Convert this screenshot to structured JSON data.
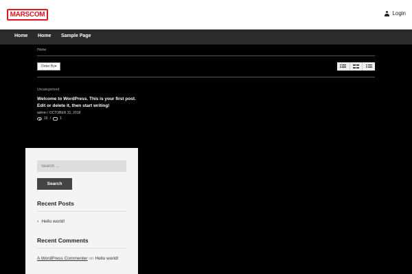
{
  "header": {
    "logo_text": "MARSCOM",
    "login_label": "Login"
  },
  "nav": {
    "items": [
      "Home",
      "Home",
      "Sample Page"
    ]
  },
  "breadcrumb": "Home",
  "toolbar": {
    "order_by_label": "Order By"
  },
  "post": {
    "category": "Uncategorized",
    "title": "Welcome to WordPress. This is your first post. Edit or delete it, then start writing!",
    "author": "admin",
    "date": "OCTOBER 31, 2018",
    "views": "16",
    "comments": "1"
  },
  "sidebar": {
    "search_placeholder": "Search ...",
    "search_button": "Search",
    "recent_posts_title": "Recent Posts",
    "recent_posts": [
      "Hello world!"
    ],
    "recent_comments_title": "Recent Comments",
    "recent_comment": {
      "author": "A WordPress Commenter",
      "on": "on",
      "post": "Hello world!"
    }
  },
  "colors": {
    "brand_red": "#e0141e",
    "nav_bg": "#2b2b2b",
    "page_bg": "#000000"
  }
}
